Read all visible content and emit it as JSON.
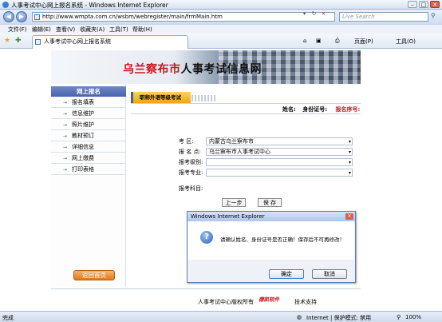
{
  "window": {
    "title": "人事考试中心网上报名系统 - Windows Internet Explorer",
    "minimize": "–",
    "maximize": "□",
    "close": "✕"
  },
  "address_bar": {
    "url": "http://www.wmpta.com.cn/wsbm/webregister/main/frmMain.htm",
    "live_search_placeholder": "Live Search"
  },
  "menu": {
    "items": [
      "文件(F)",
      "编辑(E)",
      "查看(V)",
      "收藏夹(A)",
      "工具(T)",
      "帮助(H)"
    ]
  },
  "tabs": {
    "active_tab": "人事考试中心网上报名系统"
  },
  "toolbar": {
    "page_label": "页面(P)",
    "tools_label": "工具(O)"
  },
  "banner": {
    "city": "乌兰察布市",
    "title_rest": "人事考试信息网"
  },
  "sidebar": {
    "heading": "网上报名",
    "items": [
      "报名填表",
      "信息维护",
      "照片维护",
      "教材预订",
      "详细信息",
      "网上缴费",
      "打印表格"
    ],
    "back_button": "返回首页"
  },
  "main": {
    "exam_tab": "职称外语等级考试",
    "name_label": "姓名:",
    "id_label": "身份证号:",
    "reg_no_label": "报名序号:",
    "form": {
      "region_label": "考    区:",
      "region_value": "内蒙古乌兰察布市",
      "site_label": "报 名 点:",
      "site_value": "乌兰察布市人事考试中心",
      "level_label": "报考级别:",
      "level_value": "",
      "major_label": "报考专业:",
      "major_value": "",
      "subject_label": "报考科目:"
    },
    "prev_button": "上一步",
    "save_button": "保 存"
  },
  "footer": {
    "copyright": "人事考试中心版权所有",
    "logo_text": "德凯软件",
    "tech_support": "技术支持"
  },
  "dialog": {
    "title": "Windows Internet Explorer",
    "message": "请确认姓名、身份证号是否正确！保存后不可再修改！",
    "ok": "确定",
    "cancel": "取消"
  },
  "status_bar": {
    "left": "完成",
    "zone": "Internet | 保护模式: 禁用",
    "zoom": "100%"
  }
}
